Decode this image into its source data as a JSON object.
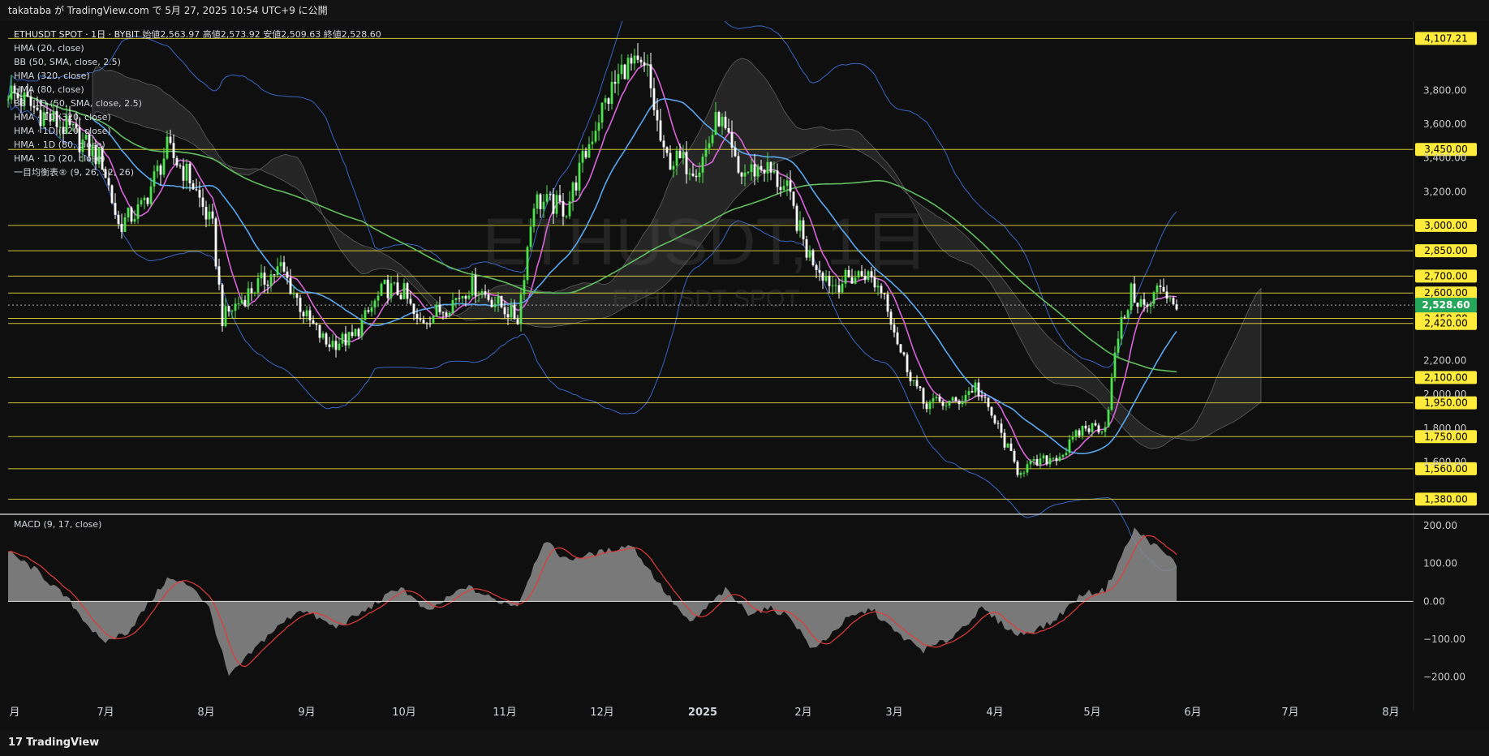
{
  "header": {
    "publish_line": "takataba が TradingView.com で 5月 27, 2025 10:54 UTC+9 に公開"
  },
  "footer": {
    "brand": "TradingView",
    "logo_glyph": "17"
  },
  "legend": {
    "symbol": "ETHUSDT SPOT · 1日 · BYBIT",
    "open_label": "始値",
    "open": "2,563.97",
    "high_label": "高値",
    "high": "2,573.92",
    "low_label": "安値",
    "low": "2,509.63",
    "close_label": "終値",
    "close": "2,528.60",
    "indicators": [
      "HMA (20, close)",
      "BB (50, SMA, close, 2.5)",
      "HMA (320, close)",
      "HMA (80, close)",
      "BB · 1D (50, SMA, close, 2.5)",
      "HMA · 1D (320, close)",
      "HMA · 1D (320, close)",
      "HMA · 1D (80, close)",
      "HMA · 1D (20, close)",
      "一目均衡表® (9, 26, 52, 26)"
    ]
  },
  "watermark": {
    "main": "ETHUSDT, 1日",
    "sub": "ETHUSDT SPOT"
  },
  "colors": {
    "up": "#4ce34c",
    "down": "#ffffff",
    "level": "#f2e03c",
    "level_label_bg": "#ffeb3b",
    "bb": "#3d6fd6",
    "hma20": "#d865d8",
    "hma80": "#5aa7ef",
    "hma320": "#62bd5e",
    "cloud": "#8a8a8a",
    "macd_hist": "#8c8c8c",
    "macd_signal": "#e23b3b",
    "current_bg": "#26a65b"
  },
  "chart_data": [
    {
      "type": "candlestick",
      "title": "ETHUSDT SPOT · 1日 · BYBIT",
      "x_ticks": [
        "月",
        "7月",
        "8月",
        "9月",
        "10月",
        "11月",
        "12月",
        "2025",
        "2月",
        "3月",
        "4月",
        "5月",
        "6月",
        "7月",
        "8月"
      ],
      "y_ticks": [
        "3,800.00",
        "3,600.00",
        "3,400.00",
        "3,200.00",
        "2,000.00",
        "1,800.00",
        "1,600.00",
        "2,200.00"
      ],
      "y_range": [
        1300,
        4200
      ],
      "horizontal_levels": [
        "4,107.21",
        "3,450.00",
        "3,000.00",
        "2,850.00",
        "2,700.00",
        "2,600.00",
        "2,450.00",
        "2,420.00",
        "2,100.00",
        "1,950.00",
        "1,750.00",
        "1,560.00",
        "1,380.00"
      ],
      "current_price": "2,528.60",
      "close_path": [
        [
          "2024-06-01",
          3800
        ],
        [
          "2024-06-10",
          3680
        ],
        [
          "2024-06-20",
          3560
        ],
        [
          "2024-06-30",
          3380
        ],
        [
          "2024-07-05",
          3000
        ],
        [
          "2024-07-12",
          3100
        ],
        [
          "2024-07-20",
          3450
        ],
        [
          "2024-07-27",
          3280
        ],
        [
          "2024-08-03",
          2980
        ],
        [
          "2024-08-06",
          2450
        ],
        [
          "2024-08-15",
          2620
        ],
        [
          "2024-08-24",
          2750
        ],
        [
          "2024-09-01",
          2450
        ],
        [
          "2024-09-07",
          2300
        ],
        [
          "2024-09-15",
          2330
        ],
        [
          "2024-09-25",
          2630
        ],
        [
          "2024-10-01",
          2600
        ],
        [
          "2024-10-05",
          2420
        ],
        [
          "2024-10-14",
          2520
        ],
        [
          "2024-10-22",
          2650
        ],
        [
          "2024-10-31",
          2520
        ],
        [
          "2024-11-05",
          2450
        ],
        [
          "2024-11-10",
          3150
        ],
        [
          "2024-11-20",
          3100
        ],
        [
          "2024-11-30",
          3650
        ],
        [
          "2024-12-08",
          3950
        ],
        [
          "2024-12-15",
          3900
        ],
        [
          "2024-12-20",
          3400
        ],
        [
          "2024-12-31",
          3350
        ],
        [
          "2025-01-06",
          3650
        ],
        [
          "2025-01-12",
          3300
        ],
        [
          "2025-01-20",
          3350
        ],
        [
          "2025-01-27",
          3200
        ],
        [
          "2025-02-02",
          2850
        ],
        [
          "2025-02-10",
          2650
        ],
        [
          "2025-02-20",
          2720
        ],
        [
          "2025-02-26",
          2600
        ],
        [
          "2025-03-03",
          2250
        ],
        [
          "2025-03-10",
          1950
        ],
        [
          "2025-03-20",
          1950
        ],
        [
          "2025-03-26",
          2050
        ],
        [
          "2025-04-02",
          1800
        ],
        [
          "2025-04-08",
          1550
        ],
        [
          "2025-04-15",
          1600
        ],
        [
          "2025-04-22",
          1650
        ],
        [
          "2025-04-28",
          1800
        ],
        [
          "2025-05-05",
          1810
        ],
        [
          "2025-05-09",
          2350
        ],
        [
          "2025-05-13",
          2600
        ],
        [
          "2025-05-18",
          2500
        ],
        [
          "2025-05-22",
          2650
        ],
        [
          "2025-05-27",
          2528.6
        ]
      ]
    },
    {
      "type": "area",
      "title": "MACD (9, 17, close)",
      "y_ticks": [
        "200.00",
        "100.00",
        "0.00",
        "−100.00",
        "−200.00"
      ],
      "y_range": [
        -250,
        230
      ],
      "macd": [
        [
          "2024-06-01",
          130
        ],
        [
          "2024-06-10",
          80
        ],
        [
          "2024-06-20",
          0
        ],
        [
          "2024-06-30",
          -110
        ],
        [
          "2024-07-08",
          -80
        ],
        [
          "2024-07-20",
          60
        ],
        [
          "2024-07-28",
          40
        ],
        [
          "2024-08-02",
          -20
        ],
        [
          "2024-08-08",
          -200
        ],
        [
          "2024-08-20",
          -90
        ],
        [
          "2024-08-30",
          -20
        ],
        [
          "2024-09-10",
          -70
        ],
        [
          "2024-09-20",
          -20
        ],
        [
          "2024-09-30",
          40
        ],
        [
          "2024-10-08",
          -30
        ],
        [
          "2024-10-20",
          40
        ],
        [
          "2024-10-30",
          0
        ],
        [
          "2024-11-05",
          -10
        ],
        [
          "2024-11-13",
          160
        ],
        [
          "2024-11-20",
          110
        ],
        [
          "2024-12-01",
          130
        ],
        [
          "2024-12-10",
          150
        ],
        [
          "2024-12-20",
          30
        ],
        [
          "2024-12-28",
          -60
        ],
        [
          "2025-01-08",
          30
        ],
        [
          "2025-01-15",
          -30
        ],
        [
          "2025-01-22",
          -20
        ],
        [
          "2025-01-28",
          -40
        ],
        [
          "2025-02-04",
          -130
        ],
        [
          "2025-02-14",
          -50
        ],
        [
          "2025-02-22",
          -20
        ],
        [
          "2025-03-01",
          -80
        ],
        [
          "2025-03-10",
          -130
        ],
        [
          "2025-03-18",
          -100
        ],
        [
          "2025-03-28",
          -20
        ],
        [
          "2025-04-08",
          -90
        ],
        [
          "2025-04-18",
          -60
        ],
        [
          "2025-04-28",
          20
        ],
        [
          "2025-05-05",
          30
        ],
        [
          "2025-05-14",
          190
        ],
        [
          "2025-05-20",
          150
        ],
        [
          "2025-05-27",
          100
        ]
      ]
    }
  ]
}
